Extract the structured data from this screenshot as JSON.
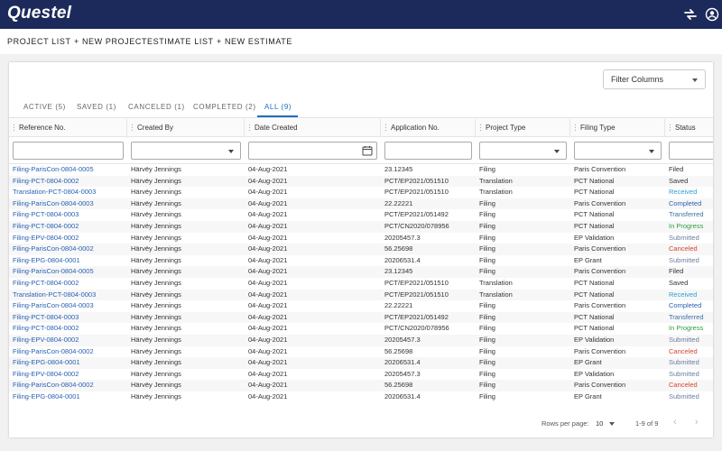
{
  "app": {
    "logo": "Questel"
  },
  "nav": [
    "PROJECT LIST",
    "+ NEW PROJECT",
    "ESTIMATE LIST",
    "+ NEW ESTIMATE"
  ],
  "filter_columns": "Filter Columns",
  "tabs": [
    "ACTIVE (5)",
    "SAVED (1)",
    "CANCELED (1)",
    "COMPLETED (2)",
    "ALL (9)"
  ],
  "columns": [
    "Reference No.",
    "Created By",
    "Date Created",
    "Application No.",
    "Project Type",
    "Filing Type",
    "Status"
  ],
  "status_colors": {
    "Filed": "#333333",
    "Saved": "#333333",
    "Received": "#2a9fd6",
    "Completed": "#2a62b5",
    "Transferred": "#3c6fa8",
    "In Progress": "#2e9e3e",
    "Submitted": "#6b7fa3",
    "Canceled": "#d9412f"
  },
  "rows": [
    [
      "Filing-ParisCon-0804-0005",
      "Härvëy Jennings",
      "04-Aug-2021",
      "23.12345",
      "Filing",
      "Paris Convention",
      "Filed"
    ],
    [
      "Filing-PCT-0804-0002",
      "Härvëy Jennings",
      "04-Aug-2021",
      "PCT/EP2021/051510",
      "Translation",
      "PCT National",
      "Saved"
    ],
    [
      "Translation-PCT-0804-0003",
      "Härvëy Jennings",
      "04-Aug-2021",
      "PCT/EP2021/051510",
      "Translation",
      "PCT National",
      "Received"
    ],
    [
      "Filing-ParisCon-0804-0003",
      "Härvëy Jennings",
      "04-Aug-2021",
      "22.22221",
      "Filing",
      "Paris Convention",
      "Completed"
    ],
    [
      "Filing-PCT-0804-0003",
      "Härvëy Jennings",
      "04-Aug-2021",
      "PCT/EP2021/051492",
      "Filing",
      "PCT National",
      "Transferred"
    ],
    [
      "Filing-PCT-0804-0002",
      "Härvëy Jennings",
      "04-Aug-2021",
      "PCT/CN2020/078956",
      "Filing",
      "PCT National",
      "In Progress"
    ],
    [
      "Filing-EPV-0804-0002",
      "Härvëy Jennings",
      "04-Aug-2021",
      "20205457.3",
      "Filing",
      "EP Validation",
      "Submitted"
    ],
    [
      "Filing-ParisCon-0804-0002",
      "Härvëy Jennings",
      "04-Aug-2021",
      "56.25698",
      "Filing",
      "Paris Convention",
      "Canceled"
    ],
    [
      "Filing-EPG-0804-0001",
      "Härvëy Jennings",
      "04-Aug-2021",
      "20206531.4",
      "Filing",
      "EP Grant",
      "Submitted"
    ],
    [
      "Filing-ParisCon-0804-0005",
      "Härvëy Jennings",
      "04-Aug-2021",
      "23.12345",
      "Filing",
      "Paris Convention",
      "Filed"
    ],
    [
      "Filing-PCT-0804-0002",
      "Härvëy Jennings",
      "04-Aug-2021",
      "PCT/EP2021/051510",
      "Translation",
      "PCT National",
      "Saved"
    ],
    [
      "Translation-PCT-0804-0003",
      "Härvëy Jennings",
      "04-Aug-2021",
      "PCT/EP2021/051510",
      "Translation",
      "PCT National",
      "Received"
    ],
    [
      "Filing-ParisCon-0804-0003",
      "Härvëy Jennings",
      "04-Aug-2021",
      "22.22221",
      "Filing",
      "Paris Convention",
      "Completed"
    ],
    [
      "Filing-PCT-0804-0003",
      "Härvëy Jennings",
      "04-Aug-2021",
      "PCT/EP2021/051492",
      "Filing",
      "PCT National",
      "Transferred"
    ],
    [
      "Filing-PCT-0804-0002",
      "Härvëy Jennings",
      "04-Aug-2021",
      "PCT/CN2020/078956",
      "Filing",
      "PCT National",
      "In Progress"
    ],
    [
      "Filing-EPV-0804-0002",
      "Härvëy Jennings",
      "04-Aug-2021",
      "20205457.3",
      "Filing",
      "EP Validation",
      "Submitted"
    ],
    [
      "Filing-ParisCon-0804-0002",
      "Härvëy Jennings",
      "04-Aug-2021",
      "56.25698",
      "Filing",
      "Paris Convention",
      "Canceled"
    ],
    [
      "Filing-EPG-0804-0001",
      "Härvëy Jennings",
      "04-Aug-2021",
      "20206531.4",
      "Filing",
      "EP Grant",
      "Submitted"
    ],
    [
      "Filing-EPV-0804-0002",
      "Härvëy Jennings",
      "04-Aug-2021",
      "20205457.3",
      "Filing",
      "EP Validation",
      "Submitted"
    ],
    [
      "Filing-ParisCon-0804-0002",
      "Härvëy Jennings",
      "04-Aug-2021",
      "56.25698",
      "Filing",
      "Paris Convention",
      "Canceled"
    ],
    [
      "Filing-EPG-0804-0001",
      "Härvëy Jennings",
      "04-Aug-2021",
      "20206531.4",
      "Filing",
      "EP Grant",
      "Submitted"
    ]
  ],
  "pagination": {
    "rows_per_page_label": "Rows per page:",
    "rows_per_page": "10",
    "range": "1-9 of 9"
  }
}
